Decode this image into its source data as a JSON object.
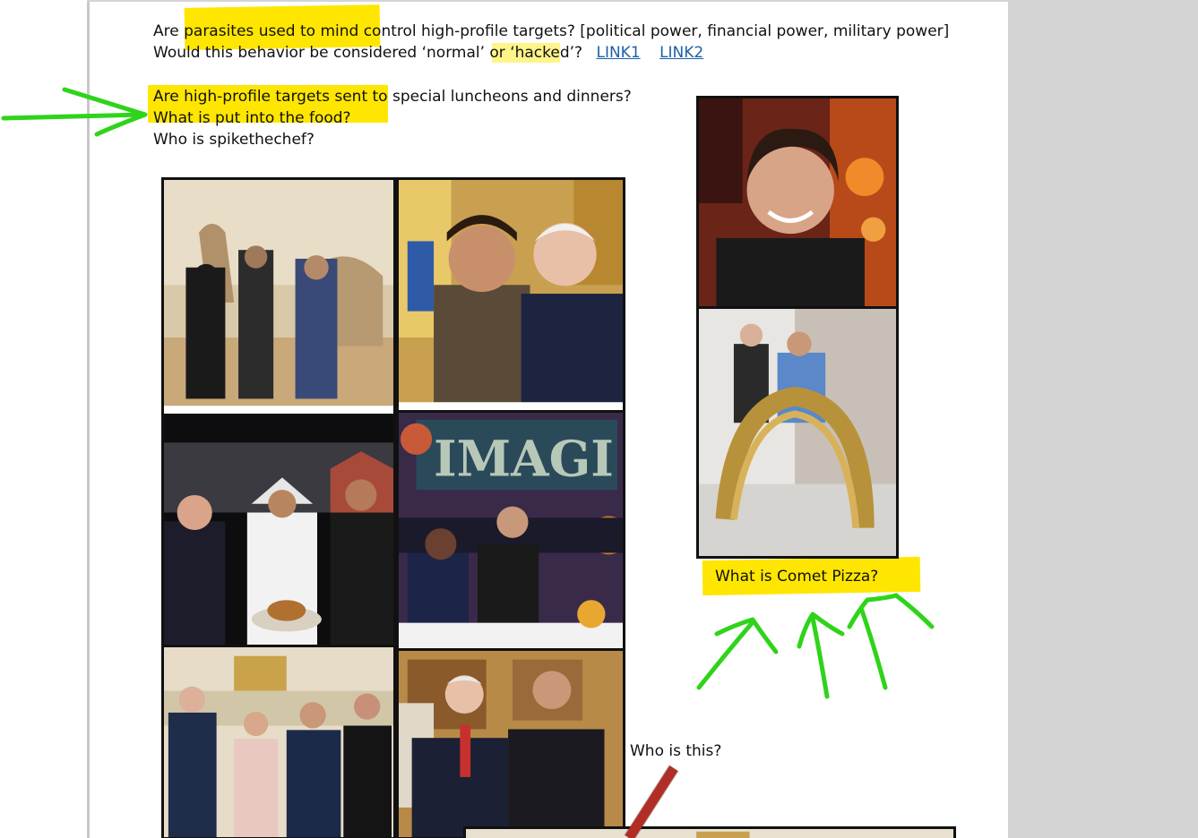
{
  "document": {
    "lines": {
      "l1_text": "Are parasites used to mind control high-profile targets?  [political power, financial power, military power]",
      "l2_prefix": "Would this behavior be considered ‘normal’ or ",
      "l2_hacked": "‘hacked’",
      "l2_suffix": "?",
      "link1": "LINK1",
      "link2": "LINK2",
      "l3_text": "Are high-profile targets sent to special luncheons and dinners?",
      "l4_text": "What is put into the food?",
      "l5_text": "Who is spikethechef?"
    },
    "comet_caption": "What is Comet Pizza?",
    "who_caption": "Who is this?"
  },
  "colors": {
    "highlight": "#ffe600",
    "arrow_green": "#2fd41a",
    "arrow_red": "#e8382f",
    "link": "#1f5fa8"
  },
  "icons": {
    "photo_camel": "photo-camel",
    "photo_biden": "photo-selfie-biden",
    "photo_saudi": "photo-saudi-burger",
    "photo_imagine": "photo-imagine-obama",
    "photo_kerry": "photo-kerry-trudeau",
    "photo_clinton": "photo-clinton",
    "photo_chef": "photo-chef-portrait",
    "photo_sculpture": "photo-sculpture"
  }
}
